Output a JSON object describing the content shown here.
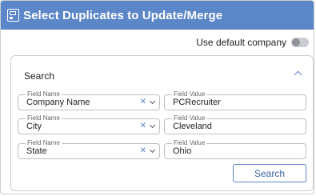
{
  "header": {
    "title": "Select Duplicates to Update/Merge",
    "icon": "document-icon"
  },
  "use_default_company": {
    "label": "Use default company",
    "enabled": false
  },
  "search_panel": {
    "title": "Search",
    "rows": [
      {
        "name_label": "Field Name",
        "name_value": "Company Name",
        "value_label": "Field Value",
        "value": "PCRecruiter"
      },
      {
        "name_label": "Field Name",
        "name_value": "City",
        "value_label": "Field Value",
        "value": "Cleveland"
      },
      {
        "name_label": "Field Name",
        "name_value": "State",
        "value_label": "Field Value",
        "value": "Ohio"
      }
    ],
    "search_button": "Search"
  },
  "colors": {
    "accent": "#5b86c8",
    "border": "#c9cdd3"
  }
}
